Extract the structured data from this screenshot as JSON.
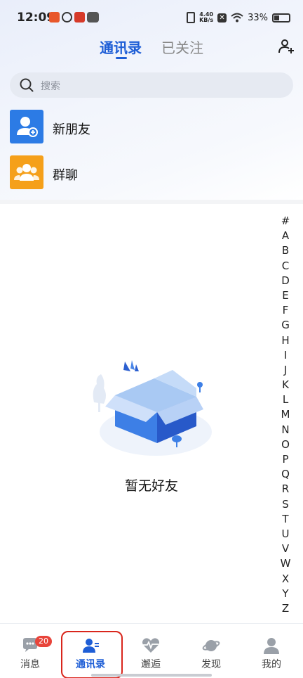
{
  "status_bar": {
    "time": "12:09",
    "net_speed_value": "4.40",
    "net_speed_unit": "KB/s",
    "battery": "33%"
  },
  "header": {
    "tabs": [
      {
        "label": "通讯录",
        "active": true
      },
      {
        "label": "已关注",
        "active": false
      }
    ],
    "add_friend_icon": "person-plus-icon"
  },
  "search": {
    "placeholder": "搜索"
  },
  "entries": [
    {
      "label": "新朋友",
      "icon": "new-friend-icon",
      "color": "#2c7be5"
    },
    {
      "label": "群聊",
      "icon": "group-chat-icon",
      "color": "#f5a01a"
    }
  ],
  "alpha_index": [
    "#",
    "A",
    "B",
    "C",
    "D",
    "E",
    "F",
    "G",
    "H",
    "I",
    "J",
    "K",
    "L",
    "M",
    "N",
    "O",
    "P",
    "Q",
    "R",
    "S",
    "T",
    "U",
    "V",
    "W",
    "X",
    "Y",
    "Z"
  ],
  "empty_state": {
    "text": "暂无好友",
    "illustration": "empty-box-illustration"
  },
  "tab_bar": {
    "items": [
      {
        "label": "消息",
        "icon": "chat-bubble-icon",
        "badge": "20",
        "active": false
      },
      {
        "label": "通讯录",
        "icon": "contacts-icon",
        "active": true
      },
      {
        "label": "邂逅",
        "icon": "heartbeat-icon",
        "active": false
      },
      {
        "label": "发现",
        "icon": "planet-icon",
        "active": false
      },
      {
        "label": "我的",
        "icon": "profile-icon",
        "active": false
      }
    ]
  },
  "colors": {
    "accent": "#1e5ed6",
    "badge": "#e8443a",
    "highlight": "#d9261c"
  }
}
